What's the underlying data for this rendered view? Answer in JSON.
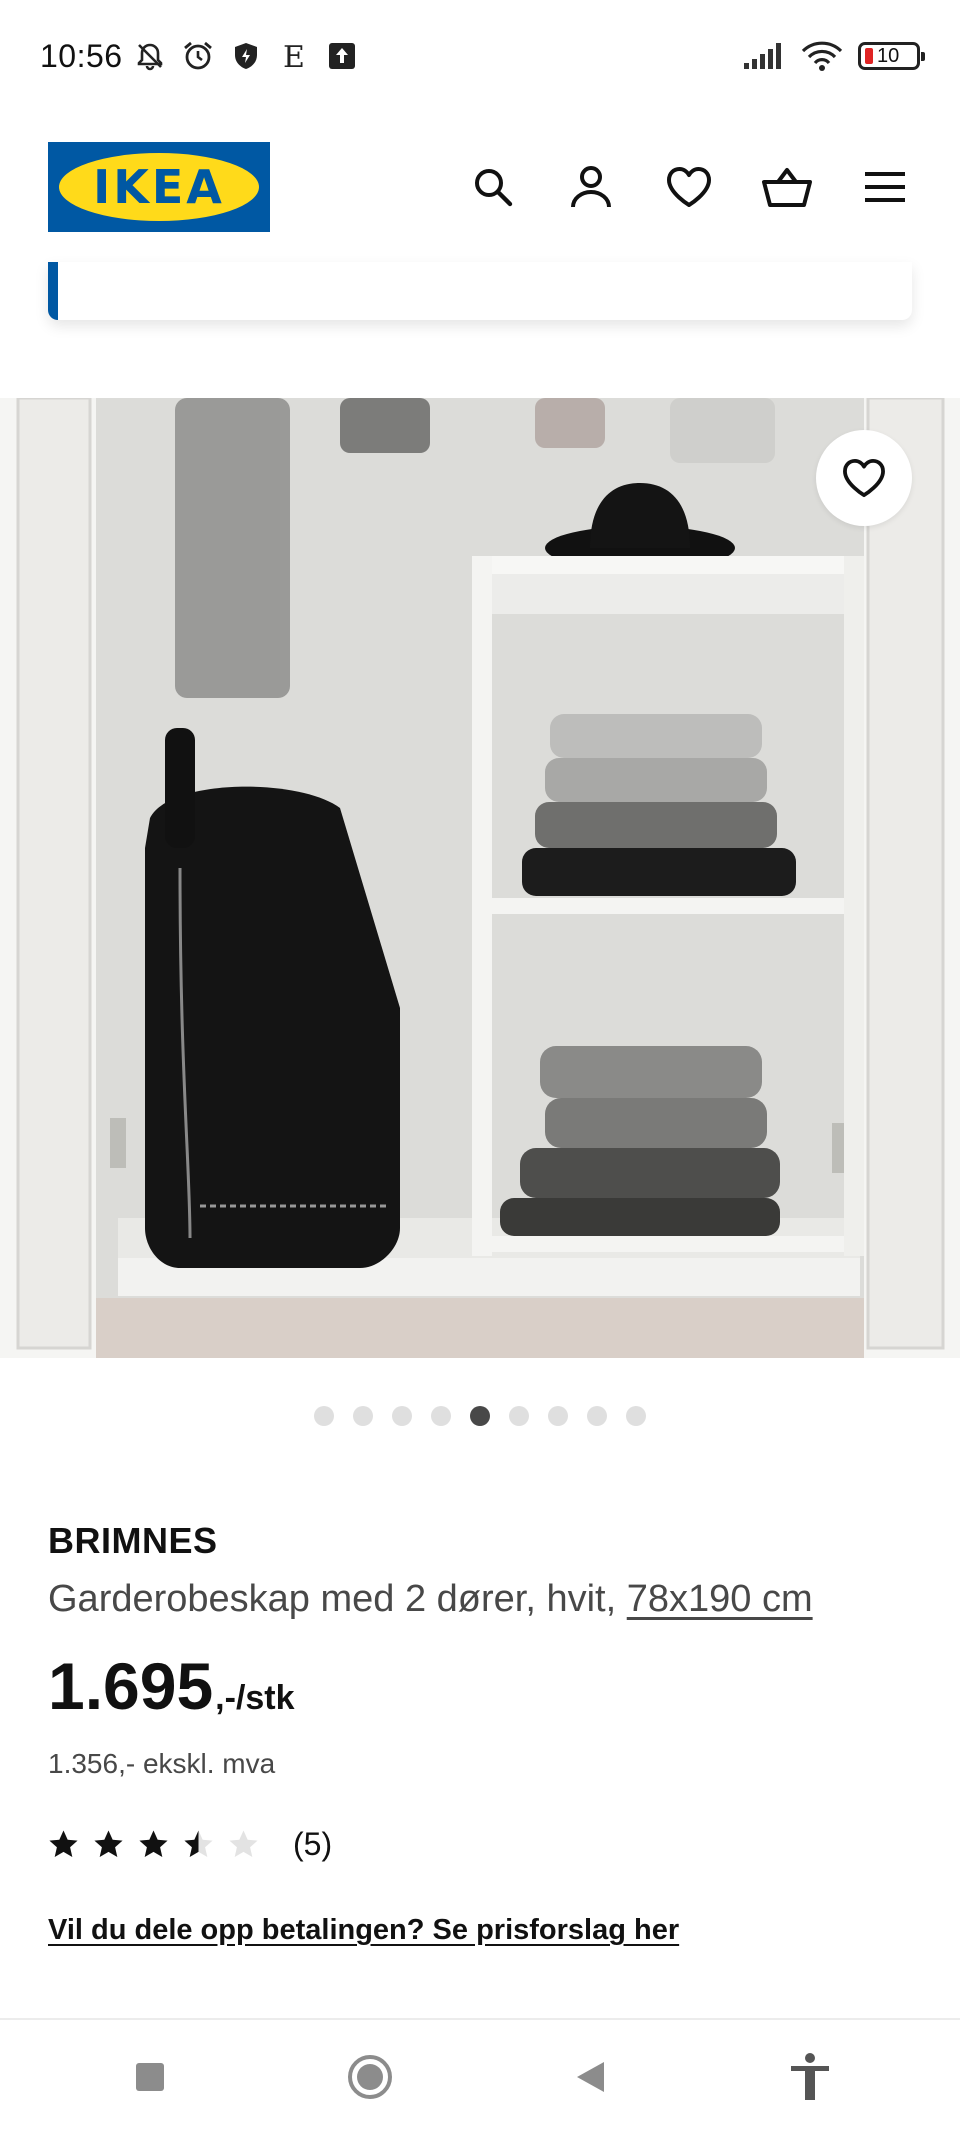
{
  "status_bar": {
    "time": "10:56",
    "left_icons": [
      "bell-off-icon",
      "alarm-icon",
      "shield-icon",
      "e-icon",
      "upload-icon"
    ],
    "right_icons": [
      "signal-icon",
      "wifi-icon",
      "battery-icon"
    ],
    "battery_level": "10",
    "battery_color": "#e02424"
  },
  "header": {
    "logo_text": "IKEA",
    "logo_colors": {
      "blue": "#0058a3",
      "yellow": "#ffda1a"
    },
    "icons": [
      "search-icon",
      "account-icon",
      "favourites-icon",
      "basket-icon",
      "menu-icon"
    ]
  },
  "gallery": {
    "total_images": 9,
    "active_index": 5
  },
  "product": {
    "brand": "BRIMNES",
    "description": "Garderobeskap med 2 dører, hvit, ",
    "size": "78x190 cm",
    "price_main": "1.695",
    "price_suffix": ",-/stk",
    "price_ex_vat": "1.356,- ekskl. mva",
    "rating": {
      "value": 3.5,
      "max": 5,
      "count": "(5)"
    },
    "split_payment_link": "Vil du dele opp betalingen? Se prisforslag her"
  },
  "nav_bar": {
    "buttons": [
      "recents-icon",
      "home-icon",
      "back-icon",
      "accessibility-icon"
    ]
  }
}
